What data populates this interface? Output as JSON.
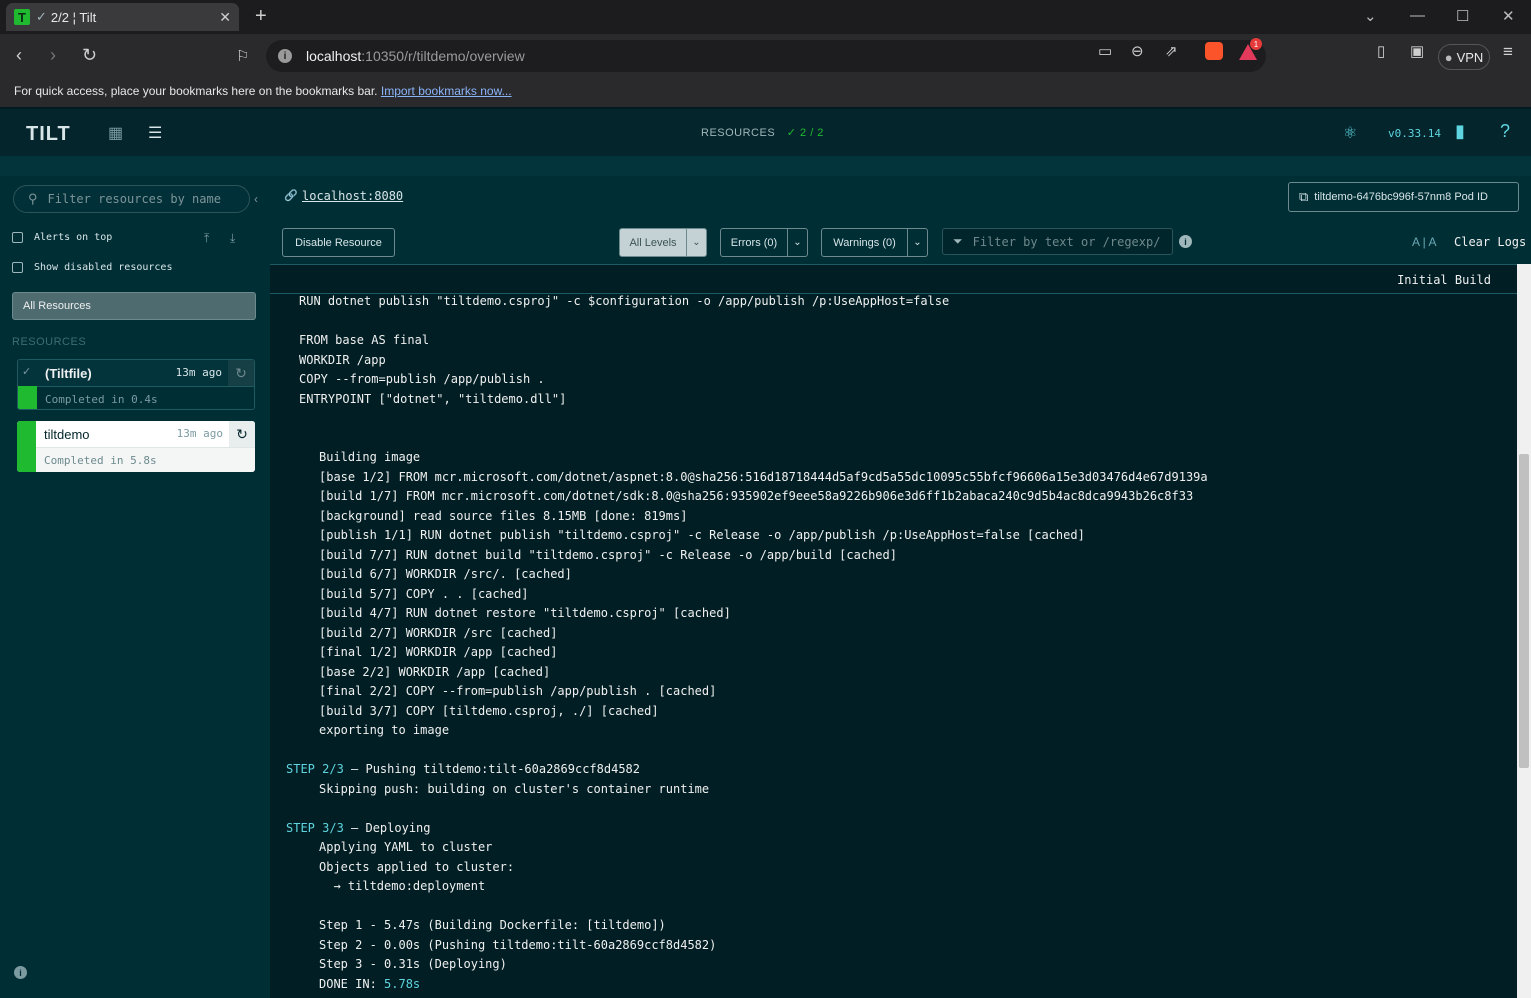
{
  "browser": {
    "tab_title": "2/2 ¦ Tilt",
    "favicon_letter": "T",
    "tab_check": "✓",
    "url_host": "localhost",
    "url_path": ":10350/r/tiltdemo/overview",
    "vpn_label": "VPN",
    "bat_count": "1",
    "bookmarks_text": "For quick access, place your bookmarks here on the bookmarks bar.",
    "bookmarks_link": "Import bookmarks now..."
  },
  "header": {
    "logo": "TILT",
    "resources_label": "RESOURCES",
    "resources_count": "✓ 2 / 2",
    "version": "v0.33.14"
  },
  "sidebar": {
    "filter_placeholder": "Filter resources by name",
    "alerts_on_top": "Alerts on top",
    "show_disabled": "Show disabled resources",
    "all_resources": "All Resources",
    "resources_heading": "RESOURCES",
    "resources": [
      {
        "name": "(Tiltfile)",
        "time": "13m ago",
        "status": "Completed in 0.4s",
        "status_color": "#20ba31"
      },
      {
        "name": "tiltdemo",
        "time": "13m ago",
        "status": "Completed in 5.8s",
        "status_color": "#20ba31"
      }
    ]
  },
  "main": {
    "endpoint": "localhost:8080",
    "pod_id": "tiltdemo-6476bc996f-57nm8 Pod ID",
    "disable_button": "Disable Resource",
    "levels": {
      "all": "All Levels",
      "errors": "Errors (0)",
      "warnings": "Warnings (0)"
    },
    "log_filter_placeholder": "Filter by text or /regexp/",
    "font_size": "A | A",
    "clear_logs": "Clear Logs",
    "section": "Initial Build"
  },
  "logs": [
    {
      "prefix": "",
      "text": "RUN dotnet publish \"tiltdemo.csproj\" -c $configuration -o /app/publish /p:UseAppHost=false",
      "suffix": "",
      "indent": 1
    },
    {
      "prefix": "",
      "text": "",
      "suffix": "",
      "indent": 0
    },
    {
      "prefix": "",
      "text": "FROM base AS final",
      "suffix": "",
      "indent": 1
    },
    {
      "prefix": "",
      "text": "WORKDIR /app",
      "suffix": "",
      "indent": 1
    },
    {
      "prefix": "",
      "text": "COPY --from=publish /app/publish .",
      "suffix": "",
      "indent": 1
    },
    {
      "prefix": "",
      "text": "ENTRYPOINT [\"dotnet\", \"tiltdemo.dll\"]",
      "suffix": "",
      "indent": 1
    },
    {
      "prefix": "",
      "text": "",
      "suffix": "",
      "indent": 0
    },
    {
      "prefix": "",
      "text": "",
      "suffix": "",
      "indent": 0
    },
    {
      "prefix": "",
      "text": "Building image",
      "suffix": "",
      "indent": 2
    },
    {
      "prefix": "",
      "text": "[base 1/2] FROM mcr.microsoft.com/dotnet/aspnet:8.0@sha256:516d18718444d5af9cd5a55dc10095c55bfcf96606a15e3d03476d4e67d9139a",
      "suffix": "",
      "indent": 2
    },
    {
      "prefix": "",
      "text": "[build 1/7] FROM mcr.microsoft.com/dotnet/sdk:8.0@sha256:935902ef9eee58a9226b906e3d6ff1b2abaca240c9d5b4ac8dca9943b26c8f33",
      "suffix": "",
      "indent": 2
    },
    {
      "prefix": "",
      "text": "[background] read source files 8.15MB [done: 819ms]",
      "suffix": "",
      "indent": 2
    },
    {
      "prefix": "",
      "text": "[publish 1/1] RUN dotnet publish \"tiltdemo.csproj\" -c Release -o /app/publish /p:UseAppHost=false [cached]",
      "suffix": "",
      "indent": 2
    },
    {
      "prefix": "",
      "text": "[build 7/7] RUN dotnet build \"tiltdemo.csproj\" -c Release -o /app/build [cached]",
      "suffix": "",
      "indent": 2
    },
    {
      "prefix": "",
      "text": "[build 6/7] WORKDIR /src/. [cached]",
      "suffix": "",
      "indent": 2
    },
    {
      "prefix": "",
      "text": "[build 5/7] COPY . . [cached]",
      "suffix": "",
      "indent": 2
    },
    {
      "prefix": "",
      "text": "[build 4/7] RUN dotnet restore \"tiltdemo.csproj\" [cached]",
      "suffix": "",
      "indent": 2
    },
    {
      "prefix": "",
      "text": "[build 2/7] WORKDIR /src [cached]",
      "suffix": "",
      "indent": 2
    },
    {
      "prefix": "",
      "text": "[final 1/2] WORKDIR /app [cached]",
      "suffix": "",
      "indent": 2
    },
    {
      "prefix": "",
      "text": "[base 2/2] WORKDIR /app [cached]",
      "suffix": "",
      "indent": 2
    },
    {
      "prefix": "",
      "text": "[final 2/2] COPY --from=publish /app/publish . [cached]",
      "suffix": "",
      "indent": 2
    },
    {
      "prefix": "",
      "text": "[build 3/7] COPY [tiltdemo.csproj, ./] [cached]",
      "suffix": "",
      "indent": 2
    },
    {
      "prefix": "",
      "text": "exporting to image",
      "suffix": "",
      "indent": 2
    },
    {
      "prefix": "",
      "text": "",
      "suffix": "",
      "indent": 0
    },
    {
      "prefix": "STEP 2/3",
      "text": " — Pushing tiltdemo:tilt-60a2869ccf8d4582",
      "suffix": "",
      "indent": 0
    },
    {
      "prefix": "",
      "text": "Skipping push: building on cluster's container runtime",
      "suffix": "",
      "indent": 2
    },
    {
      "prefix": "",
      "text": "",
      "suffix": "",
      "indent": 0
    },
    {
      "prefix": "STEP 3/3",
      "text": " — Deploying",
      "suffix": "",
      "indent": 0
    },
    {
      "prefix": "",
      "text": "Applying YAML to cluster",
      "suffix": "",
      "indent": 2
    },
    {
      "prefix": "",
      "text": "Objects applied to cluster:",
      "suffix": "",
      "indent": 2
    },
    {
      "prefix": "",
      "text": "  → tiltdemo:deployment",
      "suffix": "",
      "indent": 2
    },
    {
      "prefix": "",
      "text": "",
      "suffix": "",
      "indent": 0
    },
    {
      "prefix": "",
      "text": "Step 1 - 5.47s (Building Dockerfile: [tiltdemo])",
      "suffix": "",
      "indent": 2
    },
    {
      "prefix": "",
      "text": "Step 2 - 0.00s (Pushing tiltdemo:tilt-60a2869ccf8d4582)",
      "suffix": "",
      "indent": 2
    },
    {
      "prefix": "",
      "text": "Step 3 - 0.31s (Deploying)",
      "suffix": "",
      "indent": 2
    },
    {
      "prefix": "",
      "text": "DONE IN: ",
      "suffix": "5.78s",
      "indent": 2
    }
  ],
  "colors": {
    "ok": "#20ba31",
    "accent": "#5ed5e0",
    "bg": "#001e23"
  }
}
